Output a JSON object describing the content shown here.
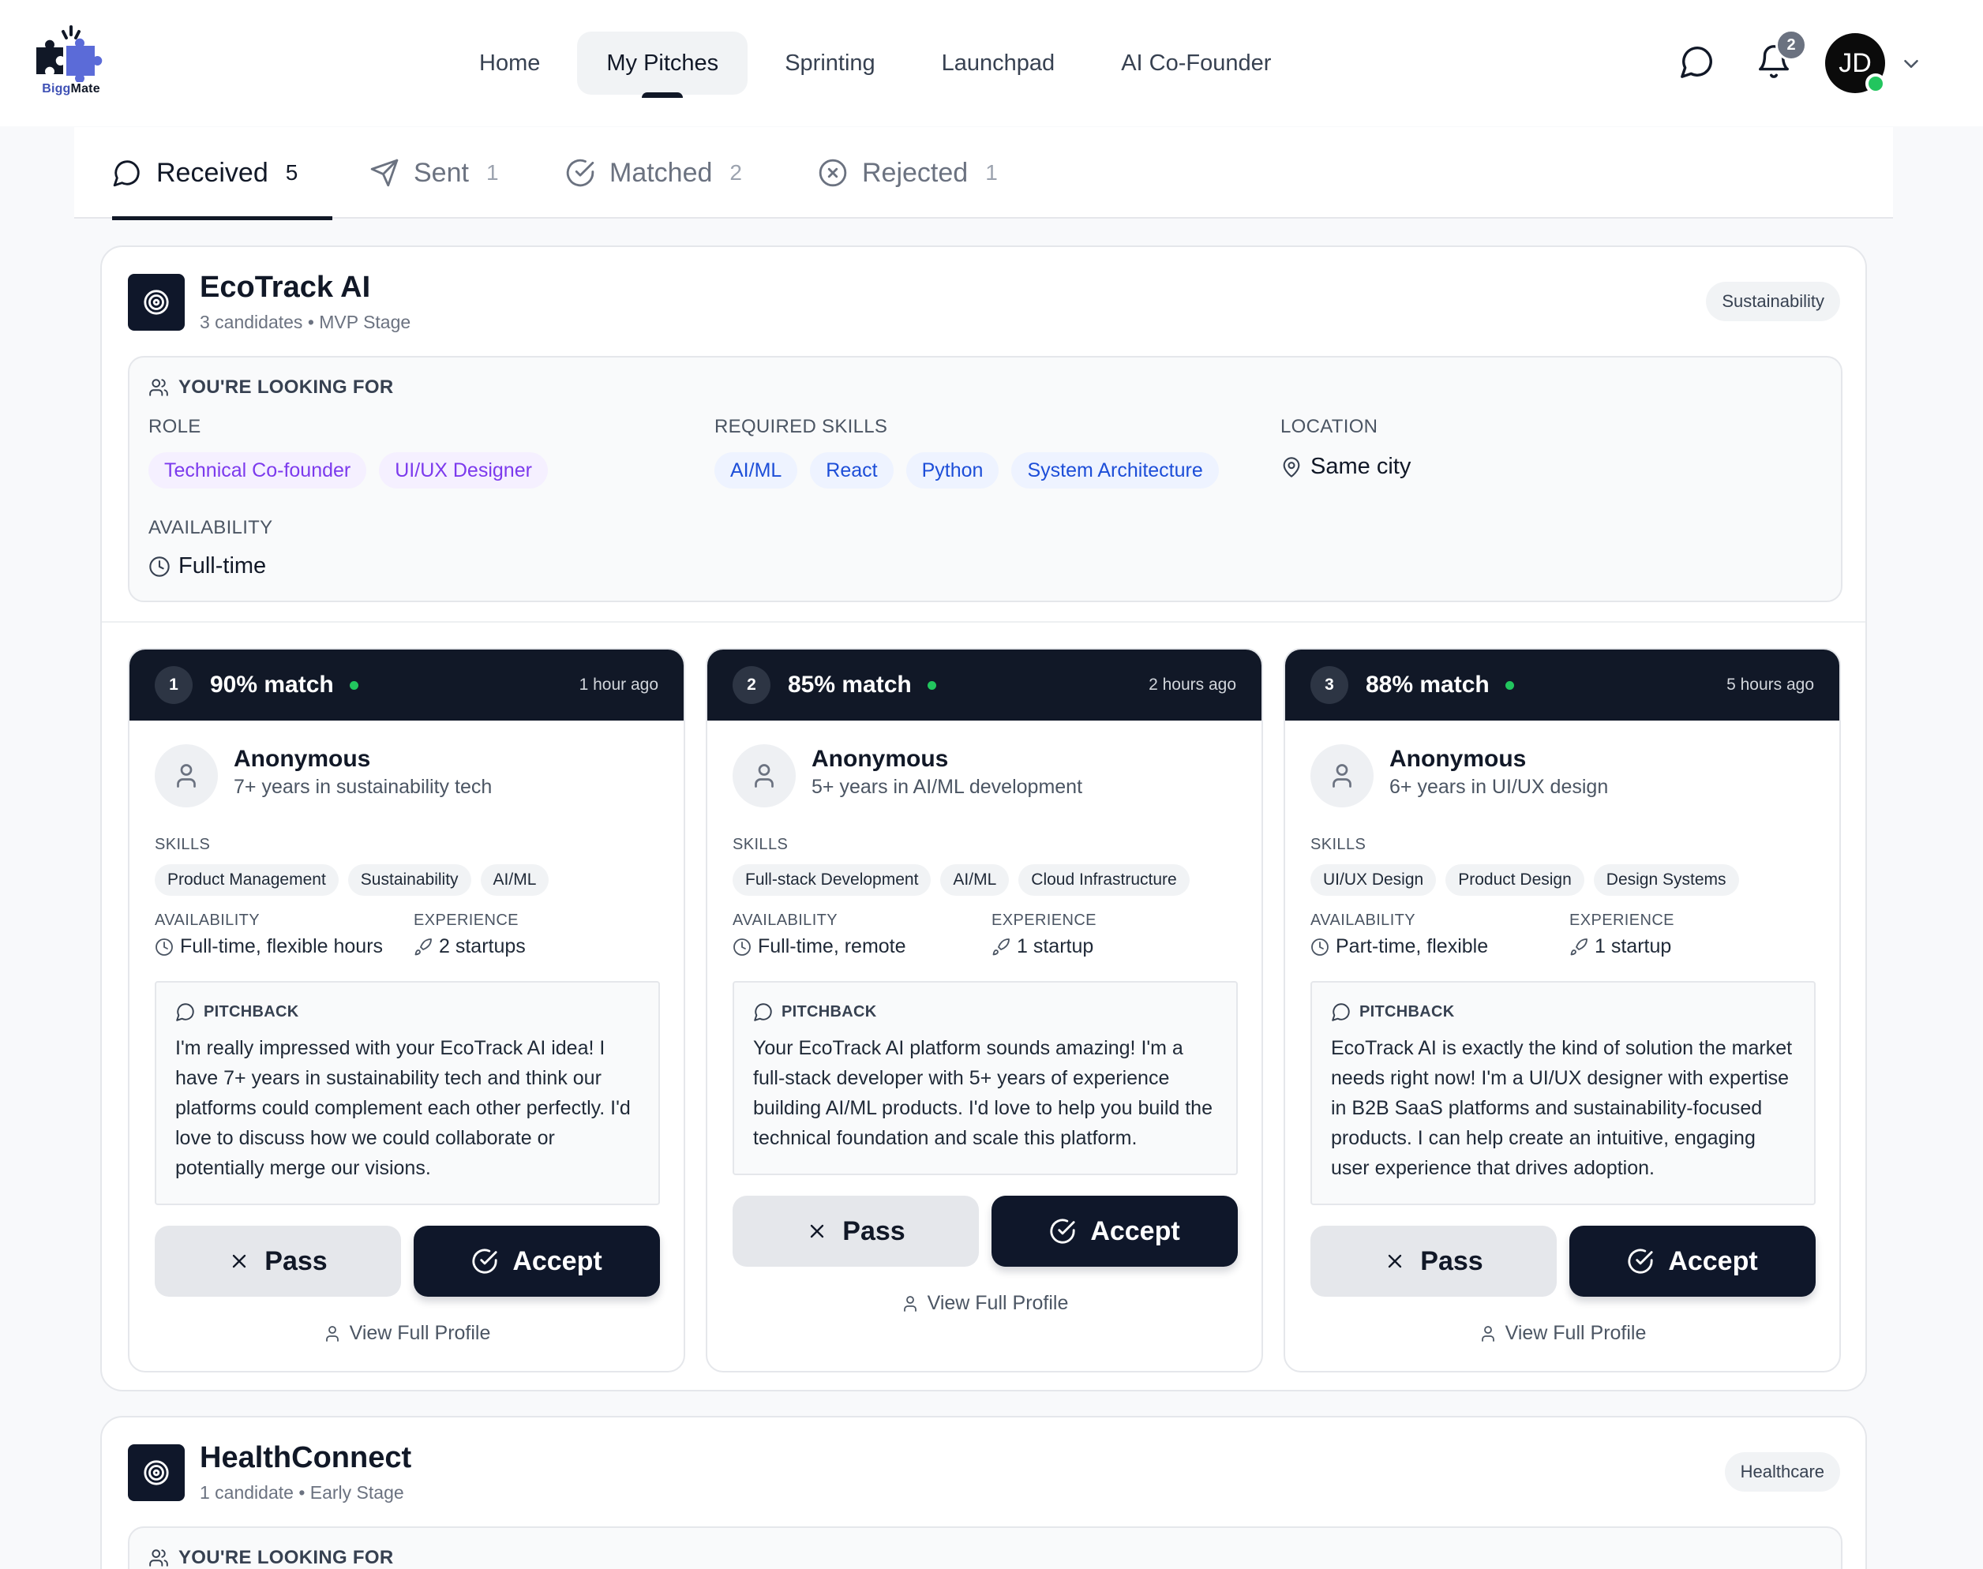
{
  "app": {
    "logo_text_a": "Bigg",
    "logo_text_b": "Mate"
  },
  "nav": {
    "items": [
      {
        "label": "Home"
      },
      {
        "label": "My Pitches"
      },
      {
        "label": "Sprinting"
      },
      {
        "label": "Launchpad"
      },
      {
        "label": "AI Co-Founder"
      }
    ],
    "active": "My Pitches",
    "notification_count": "2",
    "avatar_initials": "JD"
  },
  "tabs": [
    {
      "label": "Received",
      "count": "5",
      "icon": "chat-bubble-icon"
    },
    {
      "label": "Sent",
      "count": "1",
      "icon": "paper-plane-icon"
    },
    {
      "label": "Matched",
      "count": "2",
      "icon": "check-circle-icon"
    },
    {
      "label": "Rejected",
      "count": "1",
      "icon": "x-circle-icon"
    }
  ],
  "pitches": [
    {
      "title": "EcoTrack AI",
      "subtitle": "3 candidates • MVP Stage",
      "category": "Sustainability",
      "looking_for": {
        "heading": "YOU'RE LOOKING FOR",
        "role_label": "ROLE",
        "roles": [
          "Technical Co-founder",
          "UI/UX Designer"
        ],
        "skills_label": "REQUIRED SKILLS",
        "skills": [
          "AI/ML",
          "React",
          "Python",
          "System Architecture"
        ],
        "location_label": "LOCATION",
        "location": "Same city",
        "availability_label": "AVAILABILITY",
        "availability": "Full-time"
      },
      "candidates": [
        {
          "rank": "1",
          "match": "90% match",
          "ago": "1 hour ago",
          "name": "Anonymous",
          "years": "7+ years in sustainability tech",
          "skills_label": "SKILLS",
          "skills": [
            "Product Management",
            "Sustainability",
            "AI/ML"
          ],
          "availability_label": "AVAILABILITY",
          "availability": "Full-time, flexible hours",
          "experience_label": "EXPERIENCE",
          "experience": "2 startups",
          "pitchback_label": "PITCHBACK",
          "pitchback": "I'm really impressed with your EcoTrack AI idea! I have 7+ years in sustainability tech and think our platforms could complement each other perfectly. I'd love to discuss how we could collaborate or potentially merge our visions.",
          "pass_label": "Pass",
          "accept_label": "Accept",
          "view_label": "View Full Profile"
        },
        {
          "rank": "2",
          "match": "85% match",
          "ago": "2 hours ago",
          "name": "Anonymous",
          "years": "5+ years in AI/ML development",
          "skills_label": "SKILLS",
          "skills": [
            "Full-stack Development",
            "AI/ML",
            "Cloud Infrastructure"
          ],
          "availability_label": "AVAILABILITY",
          "availability": "Full-time, remote",
          "experience_label": "EXPERIENCE",
          "experience": "1 startup",
          "pitchback_label": "PITCHBACK",
          "pitchback": "Your EcoTrack AI platform sounds amazing! I'm a full-stack developer with 5+ years of experience building AI/ML products. I'd love to help you build the technical foundation and scale this platform.",
          "pass_label": "Pass",
          "accept_label": "Accept",
          "view_label": "View Full Profile"
        },
        {
          "rank": "3",
          "match": "88% match",
          "ago": "5 hours ago",
          "name": "Anonymous",
          "years": "6+ years in UI/UX design",
          "skills_label": "SKILLS",
          "skills": [
            "UI/UX Design",
            "Product Design",
            "Design Systems"
          ],
          "availability_label": "AVAILABILITY",
          "availability": "Part-time, flexible",
          "experience_label": "EXPERIENCE",
          "experience": "1 startup",
          "pitchback_label": "PITCHBACK",
          "pitchback": "EcoTrack AI is exactly the kind of solution the market needs right now! I'm a UI/UX designer with expertise in B2B SaaS platforms and sustainability-focused products. I can help create an intuitive, engaging user experience that drives adoption.",
          "pass_label": "Pass",
          "accept_label": "Accept",
          "view_label": "View Full Profile"
        }
      ]
    },
    {
      "title": "HealthConnect",
      "subtitle": "1 candidate • Early Stage",
      "category": "Healthcare",
      "looking_for": {
        "heading": "YOU'RE LOOKING FOR"
      }
    }
  ],
  "colors": {
    "accent_dark": "#111827",
    "online": "#22c55e",
    "role_chip": "#7c3aed",
    "skill_chip": "#1d4ed8"
  }
}
